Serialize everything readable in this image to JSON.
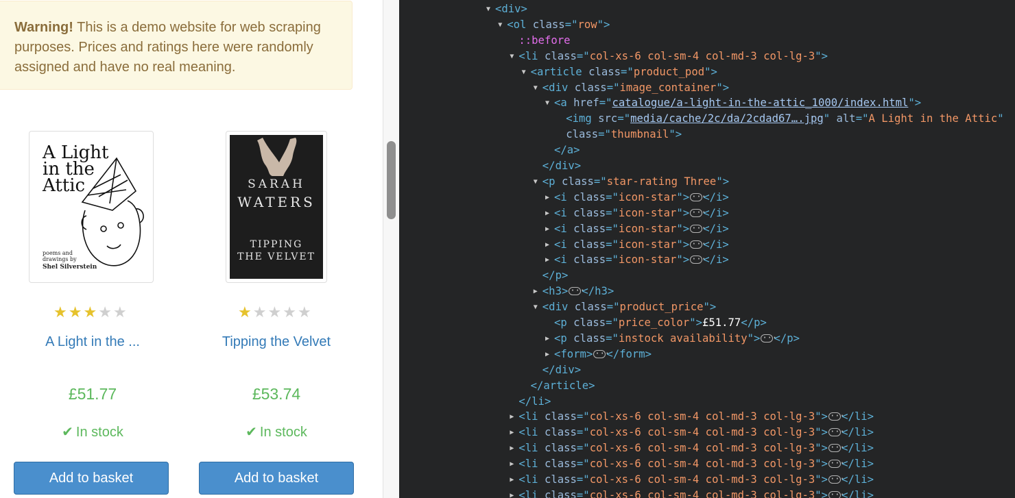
{
  "alert": {
    "bold": "Warning!",
    "message": " This is a demo website for web scraping purposes. Prices and ratings here were randomly assigned and have no real meaning."
  },
  "products": [
    {
      "title": "A Light in the ...",
      "price": "£51.77",
      "stock": "In stock",
      "button": "Add to basket",
      "rating": 3,
      "cover": {
        "title_lines": [
          "A Light",
          "in the",
          "Attic"
        ],
        "subtitle_lines": [
          "poems and",
          "drawings by"
        ],
        "author": "Shel Silverstein"
      }
    },
    {
      "title": "Tipping the Velvet",
      "price": "£53.74",
      "stock": "In stock",
      "button": "Add to basket",
      "rating": 1,
      "cover": {
        "author_lines": [
          "SARAH",
          "WATERS"
        ],
        "title_lines": [
          "TIPPING",
          "THE VELVET"
        ]
      }
    }
  ],
  "devtools": {
    "lines": [
      {
        "indent": 0,
        "toggle": "open",
        "segs": [
          [
            "tag",
            "<div>"
          ]
        ]
      },
      {
        "indent": 1,
        "toggle": "open",
        "segs": [
          [
            "tag",
            "<ol "
          ],
          [
            "attr",
            "class"
          ],
          [
            "tag",
            "=\""
          ],
          [
            "val",
            "row"
          ],
          [
            "tag",
            "\">"
          ]
        ]
      },
      {
        "indent": 2,
        "toggle": "none",
        "segs": [
          [
            "pseudo",
            "::before"
          ]
        ]
      },
      {
        "indent": 2,
        "toggle": "open",
        "segs": [
          [
            "tag",
            "<li "
          ],
          [
            "attr",
            "class"
          ],
          [
            "tag",
            "=\""
          ],
          [
            "val",
            "col-xs-6 col-sm-4 col-md-3 col-lg-3"
          ],
          [
            "tag",
            "\">"
          ]
        ]
      },
      {
        "indent": 3,
        "toggle": "open",
        "segs": [
          [
            "tag",
            "<article "
          ],
          [
            "attr",
            "class"
          ],
          [
            "tag",
            "=\""
          ],
          [
            "val",
            "product_pod"
          ],
          [
            "tag",
            "\">"
          ]
        ]
      },
      {
        "indent": 4,
        "toggle": "open",
        "segs": [
          [
            "tag",
            "<div "
          ],
          [
            "attr",
            "class"
          ],
          [
            "tag",
            "=\""
          ],
          [
            "val",
            "image_container"
          ],
          [
            "tag",
            "\">"
          ]
        ]
      },
      {
        "indent": 5,
        "toggle": "open",
        "segs": [
          [
            "tag",
            "<a "
          ],
          [
            "attr",
            "href"
          ],
          [
            "tag",
            "=\""
          ],
          [
            "lnk",
            "catalogue/a-light-in-the-attic_1000/index.html"
          ],
          [
            "tag",
            "\">"
          ]
        ]
      },
      {
        "indent": 6,
        "toggle": "none",
        "segs": [
          [
            "tag",
            "<img "
          ],
          [
            "attr",
            "src"
          ],
          [
            "tag",
            "=\""
          ],
          [
            "lnk",
            "media/cache/2c/da/2cdad67….jpg"
          ],
          [
            "tag",
            "\" "
          ],
          [
            "attr",
            "alt"
          ],
          [
            "tag",
            "=\""
          ],
          [
            "val",
            "A Light in the Attic"
          ],
          [
            "tag",
            "\""
          ]
        ]
      },
      {
        "indent": 6,
        "toggle": "none",
        "segs": [
          [
            "attr",
            "class"
          ],
          [
            "tag",
            "=\""
          ],
          [
            "val",
            "thumbnail"
          ],
          [
            "tag",
            "\">"
          ]
        ]
      },
      {
        "indent": 5,
        "toggle": "none",
        "segs": [
          [
            "tag",
            "</a>"
          ]
        ]
      },
      {
        "indent": 4,
        "toggle": "none",
        "segs": [
          [
            "tag",
            "</div>"
          ]
        ]
      },
      {
        "indent": 4,
        "toggle": "open",
        "segs": [
          [
            "tag",
            "<p "
          ],
          [
            "attr",
            "class"
          ],
          [
            "tag",
            "=\""
          ],
          [
            "val",
            "star-rating Three"
          ],
          [
            "tag",
            "\">"
          ]
        ]
      },
      {
        "indent": 5,
        "toggle": "closed",
        "segs": [
          [
            "tag",
            "<i "
          ],
          [
            "attr",
            "class"
          ],
          [
            "tag",
            "=\""
          ],
          [
            "val",
            "icon-star"
          ],
          [
            "tag",
            "\">"
          ],
          [
            "ell",
            ""
          ],
          [
            "tag",
            "</i>"
          ]
        ]
      },
      {
        "indent": 5,
        "toggle": "closed",
        "segs": [
          [
            "tag",
            "<i "
          ],
          [
            "attr",
            "class"
          ],
          [
            "tag",
            "=\""
          ],
          [
            "val",
            "icon-star"
          ],
          [
            "tag",
            "\">"
          ],
          [
            "ell",
            ""
          ],
          [
            "tag",
            "</i>"
          ]
        ]
      },
      {
        "indent": 5,
        "toggle": "closed",
        "segs": [
          [
            "tag",
            "<i "
          ],
          [
            "attr",
            "class"
          ],
          [
            "tag",
            "=\""
          ],
          [
            "val",
            "icon-star"
          ],
          [
            "tag",
            "\">"
          ],
          [
            "ell",
            ""
          ],
          [
            "tag",
            "</i>"
          ]
        ]
      },
      {
        "indent": 5,
        "toggle": "closed",
        "segs": [
          [
            "tag",
            "<i "
          ],
          [
            "attr",
            "class"
          ],
          [
            "tag",
            "=\""
          ],
          [
            "val",
            "icon-star"
          ],
          [
            "tag",
            "\">"
          ],
          [
            "ell",
            ""
          ],
          [
            "tag",
            "</i>"
          ]
        ]
      },
      {
        "indent": 5,
        "toggle": "closed",
        "segs": [
          [
            "tag",
            "<i "
          ],
          [
            "attr",
            "class"
          ],
          [
            "tag",
            "=\""
          ],
          [
            "val",
            "icon-star"
          ],
          [
            "tag",
            "\">"
          ],
          [
            "ell",
            ""
          ],
          [
            "tag",
            "</i>"
          ]
        ]
      },
      {
        "indent": 4,
        "toggle": "none",
        "segs": [
          [
            "tag",
            "</p>"
          ]
        ]
      },
      {
        "indent": 4,
        "toggle": "closed",
        "segs": [
          [
            "tag",
            "<h3>"
          ],
          [
            "ell",
            ""
          ],
          [
            "tag",
            "</h3>"
          ]
        ]
      },
      {
        "indent": 4,
        "toggle": "open",
        "segs": [
          [
            "tag",
            "<div "
          ],
          [
            "attr",
            "class"
          ],
          [
            "tag",
            "=\""
          ],
          [
            "val",
            "product_price"
          ],
          [
            "tag",
            "\">"
          ]
        ]
      },
      {
        "indent": 5,
        "toggle": "none",
        "segs": [
          [
            "tag",
            "<p "
          ],
          [
            "attr",
            "class"
          ],
          [
            "tag",
            "=\""
          ],
          [
            "val",
            "price_color"
          ],
          [
            "tag",
            "\">"
          ],
          [
            "text",
            "£51.77"
          ],
          [
            "tag",
            "</p>"
          ]
        ]
      },
      {
        "indent": 5,
        "toggle": "closed",
        "segs": [
          [
            "tag",
            "<p "
          ],
          [
            "attr",
            "class"
          ],
          [
            "tag",
            "=\""
          ],
          [
            "val",
            "instock availability"
          ],
          [
            "tag",
            "\">"
          ],
          [
            "ell",
            ""
          ],
          [
            "tag",
            "</p>"
          ]
        ]
      },
      {
        "indent": 5,
        "toggle": "closed",
        "segs": [
          [
            "tag",
            "<form>"
          ],
          [
            "ell",
            ""
          ],
          [
            "tag",
            "</form>"
          ]
        ]
      },
      {
        "indent": 4,
        "toggle": "none",
        "segs": [
          [
            "tag",
            "</div>"
          ]
        ]
      },
      {
        "indent": 3,
        "toggle": "none",
        "segs": [
          [
            "tag",
            "</article>"
          ]
        ]
      },
      {
        "indent": 2,
        "toggle": "none",
        "segs": [
          [
            "tag",
            "</li>"
          ]
        ]
      },
      {
        "indent": 2,
        "toggle": "closed",
        "segs": [
          [
            "tag",
            "<li "
          ],
          [
            "attr",
            "class"
          ],
          [
            "tag",
            "=\""
          ],
          [
            "val",
            "col-xs-6 col-sm-4 col-md-3 col-lg-3"
          ],
          [
            "tag",
            "\">"
          ],
          [
            "ell",
            ""
          ],
          [
            "tag",
            "</li>"
          ]
        ]
      },
      {
        "indent": 2,
        "toggle": "closed",
        "segs": [
          [
            "tag",
            "<li "
          ],
          [
            "attr",
            "class"
          ],
          [
            "tag",
            "=\""
          ],
          [
            "val",
            "col-xs-6 col-sm-4 col-md-3 col-lg-3"
          ],
          [
            "tag",
            "\">"
          ],
          [
            "ell",
            ""
          ],
          [
            "tag",
            "</li>"
          ]
        ]
      },
      {
        "indent": 2,
        "toggle": "closed",
        "segs": [
          [
            "tag",
            "<li "
          ],
          [
            "attr",
            "class"
          ],
          [
            "tag",
            "=\""
          ],
          [
            "val",
            "col-xs-6 col-sm-4 col-md-3 col-lg-3"
          ],
          [
            "tag",
            "\">"
          ],
          [
            "ell",
            ""
          ],
          [
            "tag",
            "</li>"
          ]
        ]
      },
      {
        "indent": 2,
        "toggle": "closed",
        "segs": [
          [
            "tag",
            "<li "
          ],
          [
            "attr",
            "class"
          ],
          [
            "tag",
            "=\""
          ],
          [
            "val",
            "col-xs-6 col-sm-4 col-md-3 col-lg-3"
          ],
          [
            "tag",
            "\">"
          ],
          [
            "ell",
            ""
          ],
          [
            "tag",
            "</li>"
          ]
        ]
      },
      {
        "indent": 2,
        "toggle": "closed",
        "segs": [
          [
            "tag",
            "<li "
          ],
          [
            "attr",
            "class"
          ],
          [
            "tag",
            "=\""
          ],
          [
            "val",
            "col-xs-6 col-sm-4 col-md-3 col-lg-3"
          ],
          [
            "tag",
            "\">"
          ],
          [
            "ell",
            ""
          ],
          [
            "tag",
            "</li>"
          ]
        ]
      },
      {
        "indent": 2,
        "toggle": "closed",
        "segs": [
          [
            "tag",
            "<li "
          ],
          [
            "attr",
            "class"
          ],
          [
            "tag",
            "=\""
          ],
          [
            "val",
            "col-xs-6 col-sm-4 col-md-3 col-lg-3"
          ],
          [
            "tag",
            "\">"
          ],
          [
            "ell",
            ""
          ],
          [
            "tag",
            "</li>"
          ]
        ]
      }
    ]
  }
}
